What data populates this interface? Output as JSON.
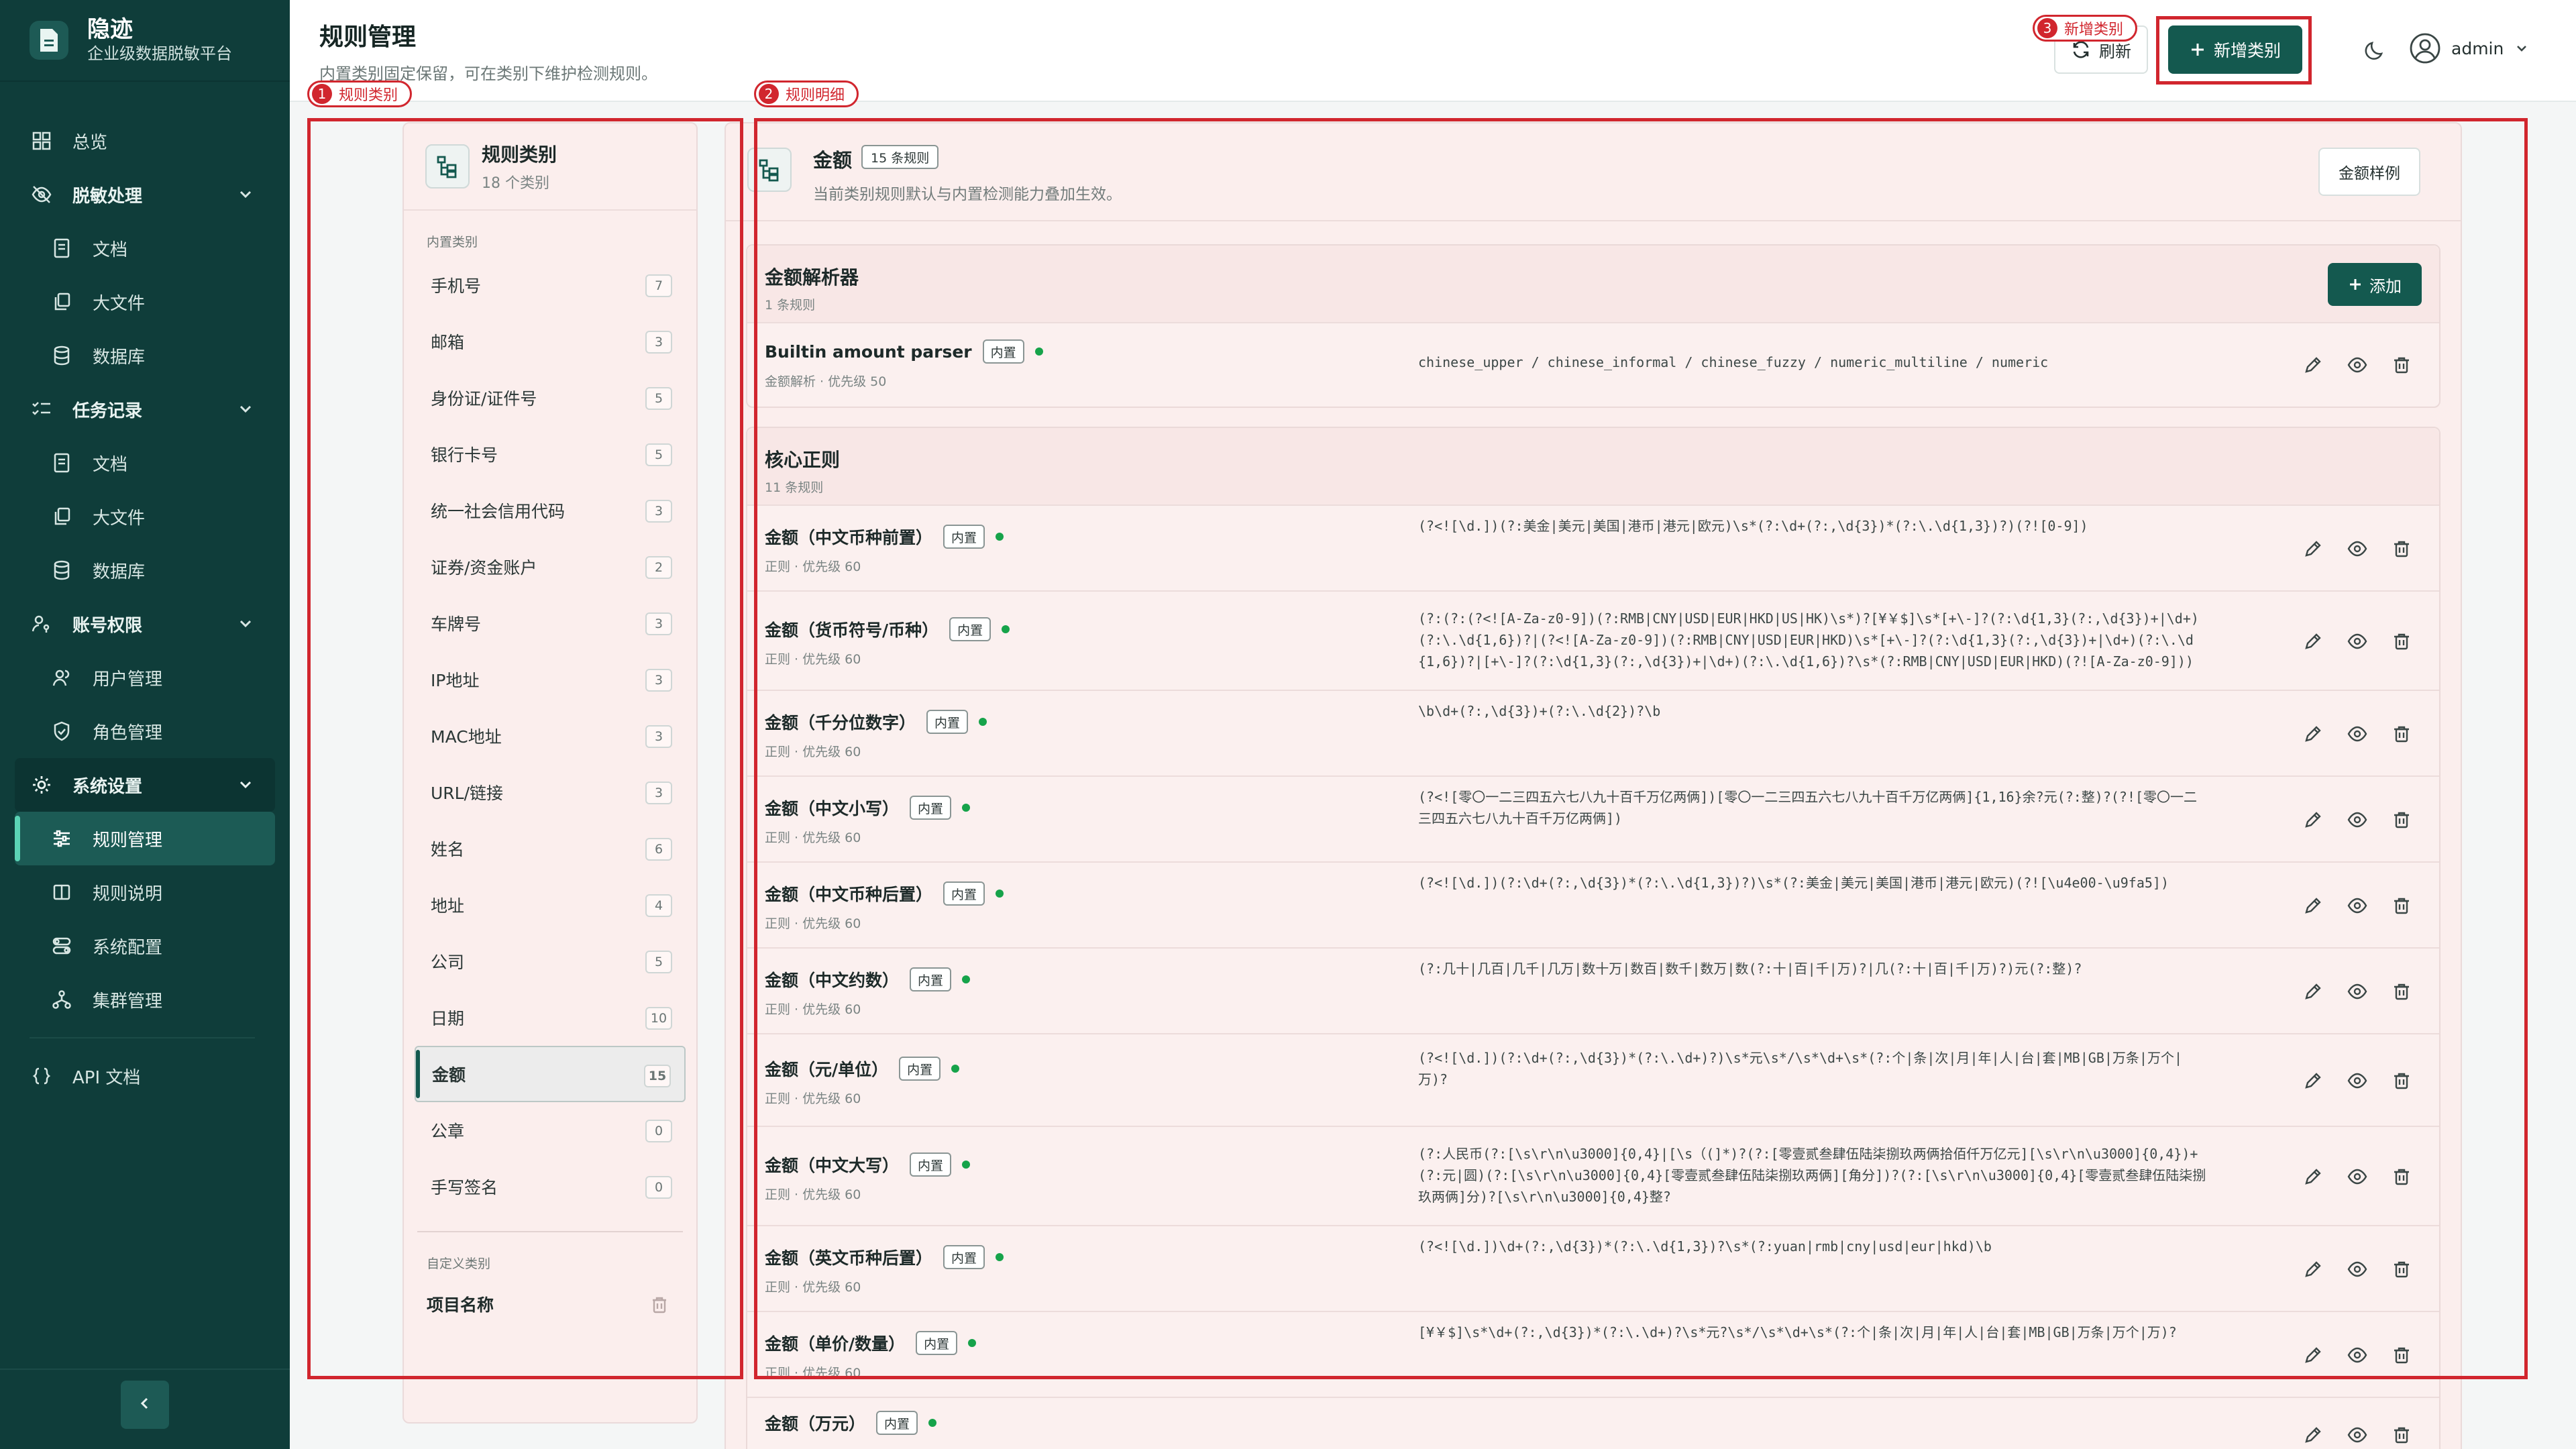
{
  "brand": {
    "title": "隐迹",
    "subtitle": "企业级数据脱敏平台"
  },
  "nav": {
    "overview": "总览",
    "desensitize": {
      "label": "脱敏处理",
      "items": [
        "文档",
        "大文件",
        "数据库"
      ]
    },
    "tasks": {
      "label": "任务记录",
      "items": [
        "文档",
        "大文件",
        "数据库"
      ]
    },
    "accounts": {
      "label": "账号权限",
      "items": [
        "用户管理",
        "角色管理"
      ]
    },
    "settings": {
      "label": "系统设置",
      "items": [
        "规则管理",
        "规则说明",
        "系统配置",
        "集群管理"
      ]
    },
    "api": "API 文档"
  },
  "header": {
    "title": "规则管理",
    "desc": "内置类别固定保留，可在类别下维护检测规则。",
    "refresh": "刷新",
    "new_category": "新增类别",
    "user": "admin"
  },
  "annotations": [
    "规则类别",
    "规则明细",
    "新增类别"
  ],
  "categories": {
    "title": "规则类别",
    "subtitle": "18 个类别",
    "builtin_label": "内置类别",
    "builtin": [
      {
        "name": "手机号",
        "count": "7"
      },
      {
        "name": "邮箱",
        "count": "3"
      },
      {
        "name": "身份证/证件号",
        "count": "5"
      },
      {
        "name": "银行卡号",
        "count": "5"
      },
      {
        "name": "统一社会信用代码",
        "count": "3"
      },
      {
        "name": "证券/资金账户",
        "count": "2"
      },
      {
        "name": "车牌号",
        "count": "3"
      },
      {
        "name": "IP地址",
        "count": "3"
      },
      {
        "name": "MAC地址",
        "count": "3"
      },
      {
        "name": "URL/链接",
        "count": "3"
      },
      {
        "name": "姓名",
        "count": "6"
      },
      {
        "name": "地址",
        "count": "4"
      },
      {
        "name": "公司",
        "count": "5"
      },
      {
        "name": "日期",
        "count": "10"
      },
      {
        "name": "金额",
        "count": "15"
      },
      {
        "name": "公章",
        "count": "0"
      },
      {
        "name": "手写签名",
        "count": "0"
      }
    ],
    "custom_label": "自定义类别",
    "custom": [
      "项目名称"
    ]
  },
  "detail": {
    "title": "金额",
    "badge": "15 条规则",
    "desc": "当前类别规则默认与内置检测能力叠加生效。",
    "sample_btn": "金额样例",
    "parser_group": {
      "title": "金额解析器",
      "sub": "1 条规则",
      "add": "添加",
      "rules": [
        {
          "name": "Builtin amount parser",
          "tag": "内置",
          "meta": "金额解析 · 优先级 50",
          "pattern": "chinese_upper / chinese_informal / chinese_fuzzy / numeric_multiline / numeric"
        }
      ]
    },
    "regex_group": {
      "title": "核心正则",
      "sub": "11 条规则",
      "rules": [
        {
          "name": "金额（中文币种前置）",
          "tag": "内置",
          "meta": "正则 · 优先级 60",
          "pattern": "(?<![\\d.])(?:美金|美元|美国|港币|港元|欧元)\\s*(?:\\d+(?:,\\d{3})*(?:\\.\\d{1,3})?)(?![0-9])"
        },
        {
          "name": "金额（货币符号/币种）",
          "tag": "内置",
          "meta": "正则 · 优先级 60",
          "pattern": "(?:(?:(?<![A-Za-z0-9])(?:RMB|CNY|USD|EUR|HKD|US|HK)\\s*)?[¥￥$]\\s*[+\\-]?(?:\\d{1,3}(?:,\\d{3})+|\\d+)(?:\\.\\d{1,6})?|(?<![A-Za-z0-9])(?:RMB|CNY|USD|EUR|HKD)\\s*[+\\-]?(?:\\d{1,3}(?:,\\d{3})+|\\d+)(?:\\.\\d{1,6})?|[+\\-]?(?:\\d{1,3}(?:,\\d{3})+|\\d+)(?:\\.\\d{1,6})?\\s*(?:RMB|CNY|USD|EUR|HKD)(?![A-Za-z0-9]))"
        },
        {
          "name": "金额（千分位数字）",
          "tag": "内置",
          "meta": "正则 · 优先级 60",
          "pattern": "\\b\\d+(?:,\\d{3})+(?:\\.\\d{2})?\\b"
        },
        {
          "name": "金额（中文小写）",
          "tag": "内置",
          "meta": "正则 · 优先级 60",
          "pattern": "(?<![零〇一二三四五六七八九十百千万亿两俩])[零〇一二三四五六七八九十百千万亿两俩]{1,16}余?元(?:整)?(?![零〇一二三四五六七八九十百千万亿两俩])"
        },
        {
          "name": "金额（中文币种后置）",
          "tag": "内置",
          "meta": "正则 · 优先级 60",
          "pattern": "(?<![\\d.])(?:\\d+(?:,\\d{3})*(?:\\.\\d{1,3})?)\\s*(?:美金|美元|美国|港币|港元|欧元)(?![\\u4e00-\\u9fa5])"
        },
        {
          "name": "金额（中文约数）",
          "tag": "内置",
          "meta": "正则 · 优先级 60",
          "pattern": "(?:几十|几百|几千|几万|数十万|数百|数千|数万|数(?:十|百|千|万)?|几(?:十|百|千|万)?)元(?:整)?"
        },
        {
          "name": "金额（元/单位）",
          "tag": "内置",
          "meta": "正则 · 优先级 60",
          "pattern": "(?<![\\d.])(?:\\d+(?:,\\d{3})*(?:\\.\\d+)?)\\s*元\\s*/\\s*\\d+\\s*(?:个|条|次|月|年|人|台|套|MB|GB|万条|万个|万)?"
        },
        {
          "name": "金额（中文大写）",
          "tag": "内置",
          "meta": "正则 · 优先级 60",
          "pattern": "(?:人民币(?:[\\s\\r\\n\\u3000]{0,4}|[\\s（(]*)?(?:[零壹贰叁肆伍陆柒捌玖两俩拾佰仟万亿元][\\s\\r\\n\\u3000]{0,4})+(?:元|圆)(?:[\\s\\r\\n\\u3000]{0,4}[零壹贰叁肆伍陆柒捌玖两俩][角分])?(?:[\\s\\r\\n\\u3000]{0,4}[零壹贰叁肆伍陆柒捌玖两俩]分)?[\\s\\r\\n\\u3000]{0,4}整?"
        },
        {
          "name": "金额（英文币种后置）",
          "tag": "内置",
          "meta": "正则 · 优先级 60",
          "pattern": "(?<![\\d.])\\d+(?:,\\d{3})*(?:\\.\\d{1,3})?\\s*(?:yuan|rmb|cny|usd|eur|hkd)\\b"
        },
        {
          "name": "金额（单价/数量）",
          "tag": "内置",
          "meta": "正则 · 优先级 60",
          "pattern": "[¥￥$]\\s*\\d+(?:,\\d{3})*(?:\\.\\d+)?\\s*元?\\s*/\\s*\\d+\\s*(?:个|条|次|月|年|人|台|套|MB|GB|万条|万个|万)?"
        },
        {
          "name": "金额（万元）",
          "tag": "内置",
          "meta": "",
          "pattern": ""
        }
      ]
    }
  }
}
